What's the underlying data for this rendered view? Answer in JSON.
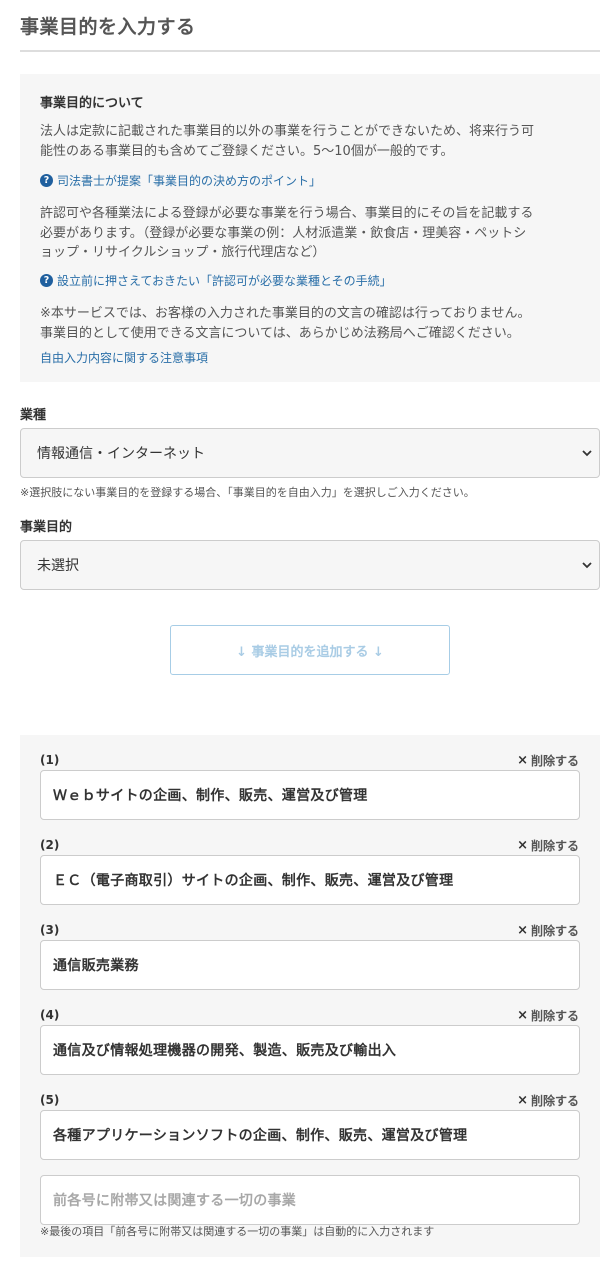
{
  "page": {
    "title": "事業目的を入力する"
  },
  "info": {
    "heading": "事業目的について",
    "para1_line1": "法人は定款に記載された事業目的以外の事業を行うことができないため、将来行う可",
    "para1_line2": "能性のある事業目的も含めてご登録ください。5〜10個が一般的です。",
    "link1": "司法書士が提案「事業目的の決め方のポイント」",
    "para2_line1": "許認可や各種業法による登録が必要な事業を行う場合、事業目的にその旨を記載する",
    "para2_line2": "必要があります。（登録が必要な事業の例：人材派遣業・飲食店・理美容・ペットシ",
    "para2_line3": "ョップ・リサイクルショップ・旅行代理店など）",
    "link2": "設立前に押さえておきたい「許認可が必要な業種とその手続」",
    "para3_line1": "※本サービスでは、お客様の入力された事業目的の文言の確認は行っておりません。",
    "para3_line2": "事業目的として使用できる文言については、あらかじめ法務局へご確認ください。",
    "link3": "自由入力内容に関する注意事項",
    "question_icon": "?"
  },
  "industry": {
    "label": "業種",
    "selected": "情報通信・インターネット",
    "note": "※選択肢にない事業目的を登録する場合、「事業目的を自由入力」を選択しご入力ください。"
  },
  "purpose_select": {
    "label": "事業目的",
    "selected": "未選択"
  },
  "add_button": "↓ 事業目的を追加する ↓",
  "items": [
    {
      "num": "(1)",
      "text": "Ｗｅｂサイトの企画、制作、販売、運営及び管理"
    },
    {
      "num": "(2)",
      "text": "ＥＣ（電子商取引）サイトの企画、制作、販売、運営及び管理"
    },
    {
      "num": "(3)",
      "text": "通信販売業務"
    },
    {
      "num": "(4)",
      "text": "通信及び情報処理機器の開発、製造、販売及び輸出入"
    },
    {
      "num": "(5)",
      "text": "各種アプリケーションソフトの企画、制作、販売、運営及び管理"
    }
  ],
  "delete_label": "削除する",
  "delete_icon": "×",
  "final_item": "前各号に附帯又は関連する一切の事業",
  "auto_note": "※最後の項目「前各号に附帯又は関連する一切の事業」は自動的に入力されます"
}
